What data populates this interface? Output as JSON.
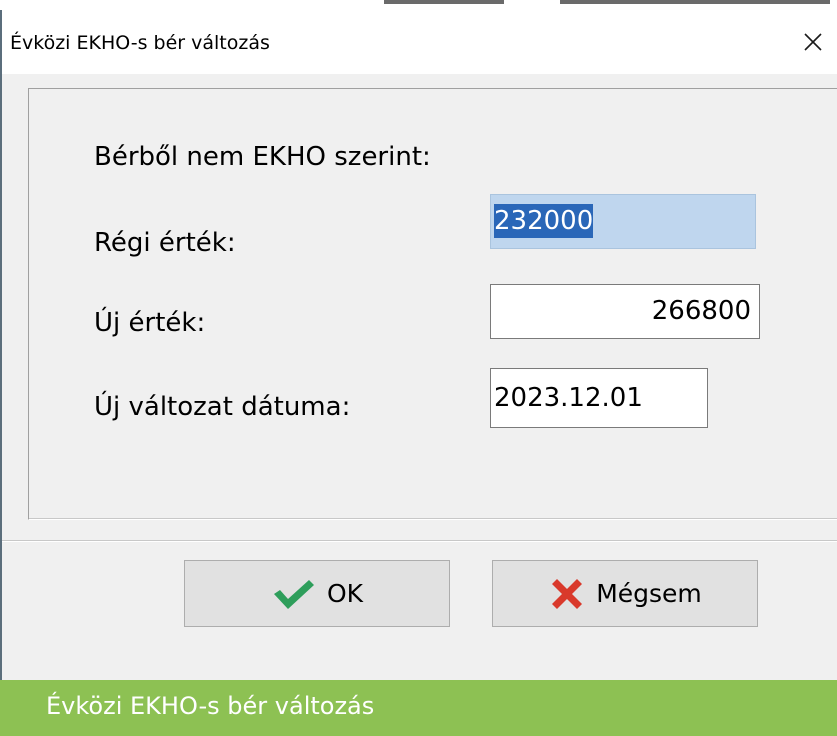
{
  "dialog": {
    "title": "Évközi EKHO-s bér változás",
    "close_icon": "close-icon"
  },
  "form": {
    "heading": "Bérből nem EKHO szerint:",
    "old_value_label": "Régi érték:",
    "old_value": "232000",
    "new_value_label": "Új érték:",
    "new_value": "266800",
    "date_label": "Új változat dátuma:",
    "date_value": "2023.12.01"
  },
  "buttons": {
    "ok_label": "OK",
    "ok_icon": "checkmark-icon",
    "cancel_label": "Mégsem",
    "cancel_icon": "red-x-icon"
  },
  "caption": {
    "text": "Évközi EKHO-s bér változás"
  },
  "colors": {
    "caption_bar": "#8dc153",
    "ok_check": "#2e9e5b",
    "cancel_x": "#d9392b",
    "selection": "#2a67b8"
  }
}
